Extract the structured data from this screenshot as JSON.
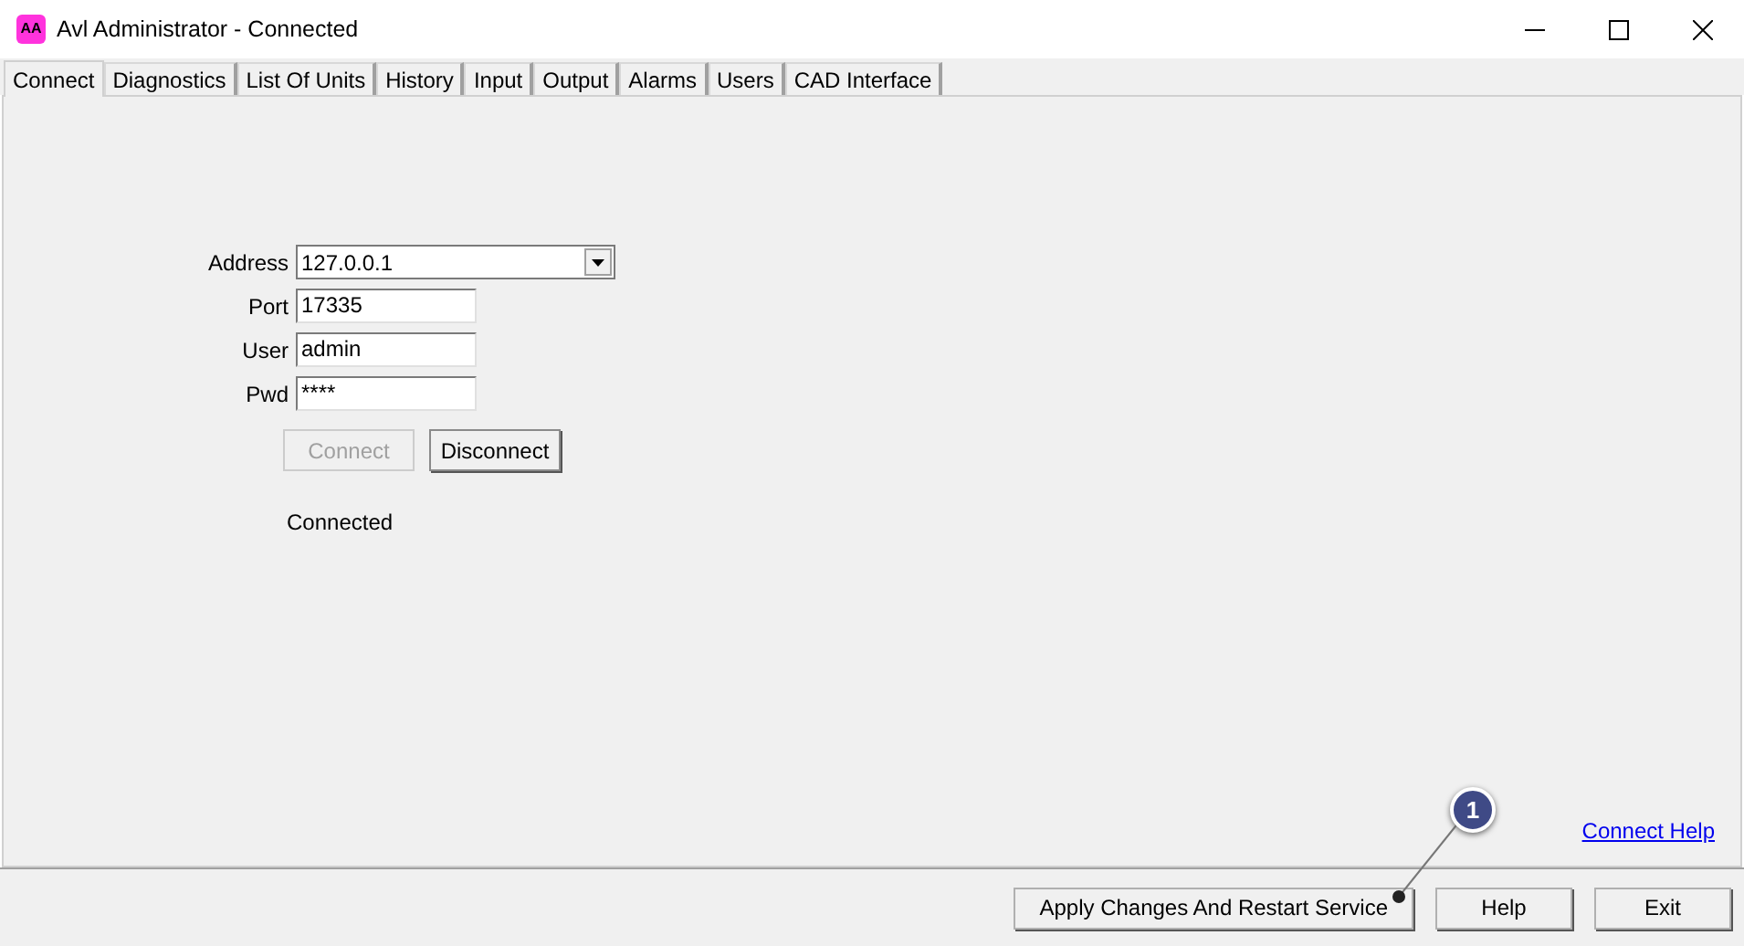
{
  "window": {
    "title": "Avl Administrator - Connected",
    "app_icon": "AA"
  },
  "tabs": [
    {
      "label": "Connect",
      "selected": true
    },
    {
      "label": "Diagnostics",
      "selected": false
    },
    {
      "label": "List Of Units",
      "selected": false
    },
    {
      "label": "History",
      "selected": false
    },
    {
      "label": "Input",
      "selected": false
    },
    {
      "label": "Output",
      "selected": false
    },
    {
      "label": "Alarms",
      "selected": false
    },
    {
      "label": "Users",
      "selected": false
    },
    {
      "label": "CAD Interface",
      "selected": false
    }
  ],
  "fields": [
    {
      "label": "Address",
      "value": "127.0.0.1",
      "kind": "combo"
    },
    {
      "label": "Port",
      "value": "17335",
      "kind": "text"
    },
    {
      "label": "User",
      "value": "admin",
      "kind": "text"
    },
    {
      "label": "Pwd",
      "value": "****",
      "kind": "text"
    }
  ],
  "buttons": [
    {
      "label": "Connect",
      "disabled": true
    },
    {
      "label": "Disconnect",
      "disabled": false
    }
  ],
  "status": "Connected",
  "help_link": "Connect Help",
  "footer_buttons": [
    "Apply Changes And Restart Service",
    "Help",
    "Exit"
  ],
  "callout": "1"
}
